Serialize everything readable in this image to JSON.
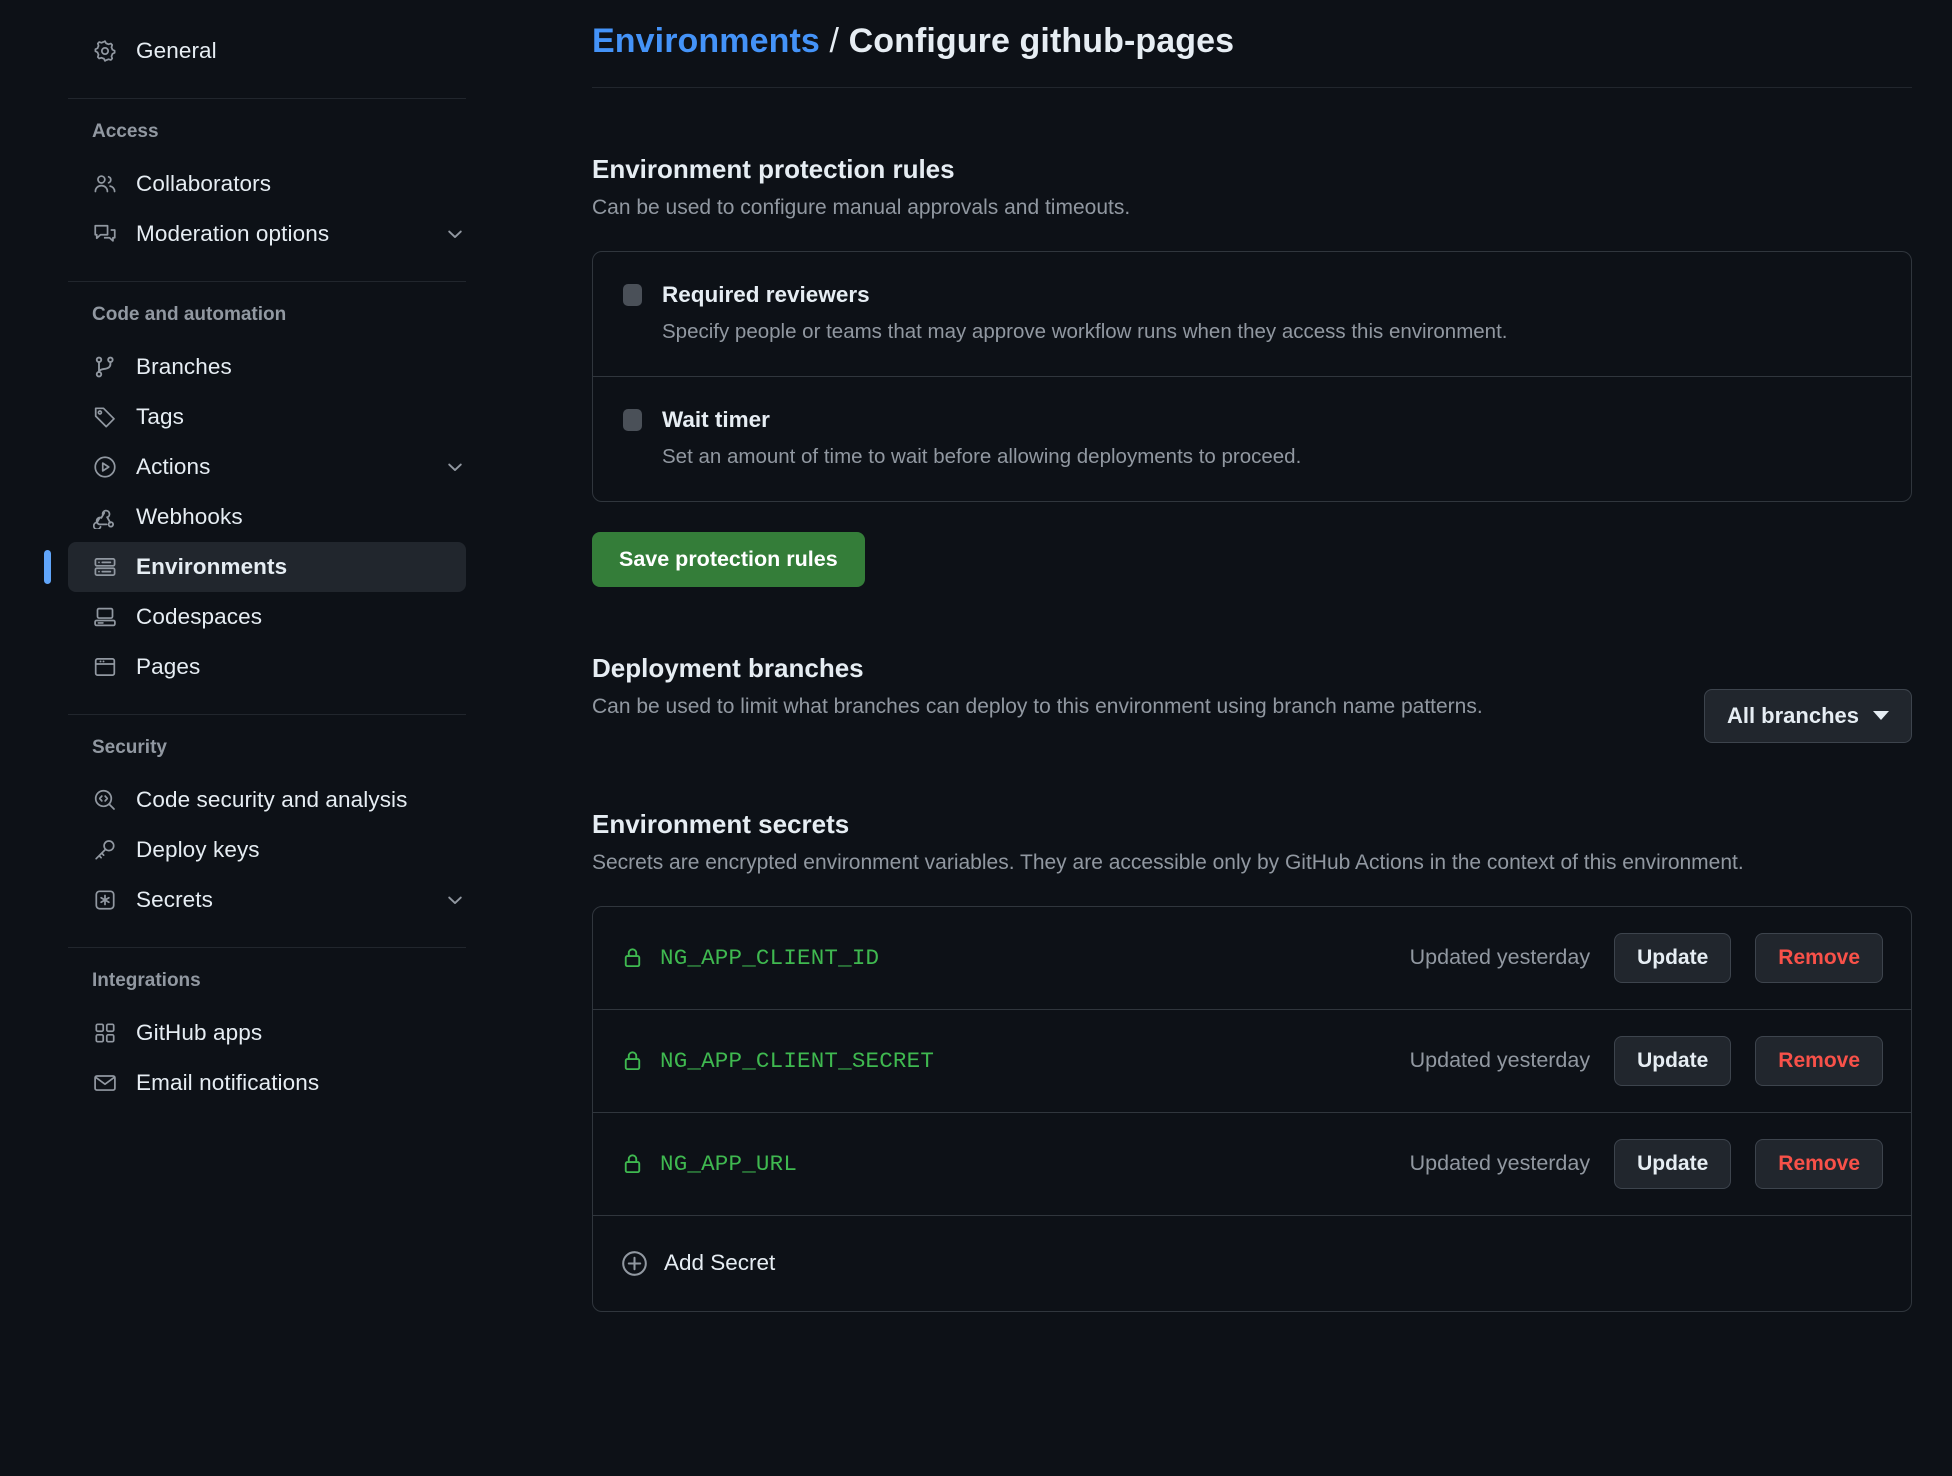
{
  "sidebar": {
    "top_items": [
      {
        "label": "General",
        "icon": "gear-icon",
        "name": "general"
      }
    ],
    "groups": [
      {
        "title": "Access",
        "items": [
          {
            "label": "Collaborators",
            "icon": "people-icon",
            "name": "collaborators",
            "chevron": false
          },
          {
            "label": "Moderation options",
            "icon": "comment-discussion-icon",
            "name": "moderation-options",
            "chevron": true
          }
        ]
      },
      {
        "title": "Code and automation",
        "items": [
          {
            "label": "Branches",
            "icon": "git-branch-icon",
            "name": "branches",
            "chevron": false
          },
          {
            "label": "Tags",
            "icon": "tag-icon",
            "name": "tags",
            "chevron": false
          },
          {
            "label": "Actions",
            "icon": "play-circle-icon",
            "name": "actions",
            "chevron": true
          },
          {
            "label": "Webhooks",
            "icon": "webhook-icon",
            "name": "webhooks",
            "chevron": false
          },
          {
            "label": "Environments",
            "icon": "server-icon",
            "name": "environments",
            "chevron": false,
            "active": true
          },
          {
            "label": "Codespaces",
            "icon": "codespaces-icon",
            "name": "codespaces",
            "chevron": false
          },
          {
            "label": "Pages",
            "icon": "browser-icon",
            "name": "pages",
            "chevron": false
          }
        ]
      },
      {
        "title": "Security",
        "items": [
          {
            "label": "Code security and analysis",
            "icon": "code-scan-icon",
            "name": "code-security-and-analysis",
            "chevron": false
          },
          {
            "label": "Deploy keys",
            "icon": "key-icon",
            "name": "deploy-keys",
            "chevron": false
          },
          {
            "label": "Secrets",
            "icon": "asterisk-box-icon",
            "name": "secrets",
            "chevron": true
          }
        ]
      },
      {
        "title": "Integrations",
        "items": [
          {
            "label": "GitHub apps",
            "icon": "apps-grid-icon",
            "name": "github-apps",
            "chevron": false
          },
          {
            "label": "Email notifications",
            "icon": "mail-icon",
            "name": "email-notifications",
            "chevron": false
          }
        ]
      }
    ]
  },
  "breadcrumb": {
    "parent": "Environments",
    "separator": "/",
    "current": "Configure github-pages"
  },
  "protection_rules": {
    "title": "Environment protection rules",
    "description": "Can be used to configure manual approvals and timeouts.",
    "rules": [
      {
        "name": "Required reviewers",
        "description": "Specify people or teams that may approve workflow runs when they access this environment.",
        "checked": false
      },
      {
        "name": "Wait timer",
        "description": "Set an amount of time to wait before allowing deployments to proceed.",
        "checked": false
      }
    ],
    "save_label": "Save protection rules"
  },
  "deployment_branches": {
    "title": "Deployment branches",
    "description": "Can be used to limit what branches can deploy to this environment using branch name patterns.",
    "selected": "All branches"
  },
  "environment_secrets": {
    "title": "Environment secrets",
    "description": "Secrets are encrypted environment variables. They are accessible only by GitHub Actions in the context of this environment.",
    "secrets": [
      {
        "name": "NG_APP_CLIENT_ID",
        "updated": "Updated yesterday",
        "update_label": "Update",
        "remove_label": "Remove"
      },
      {
        "name": "NG_APP_CLIENT_SECRET",
        "updated": "Updated yesterday",
        "update_label": "Update",
        "remove_label": "Remove"
      },
      {
        "name": "NG_APP_URL",
        "updated": "Updated yesterday",
        "update_label": "Update",
        "remove_label": "Remove"
      }
    ],
    "add_label": "Add Secret"
  },
  "colors": {
    "page_bg": "#0d1117",
    "accent_link": "#4493f8",
    "active_bar": "#60a5fa",
    "save_button": "#347d39",
    "secret_green": "#3fb950",
    "danger_red": "#f85149",
    "muted_text": "#9198a1",
    "border": "#30363d"
  }
}
